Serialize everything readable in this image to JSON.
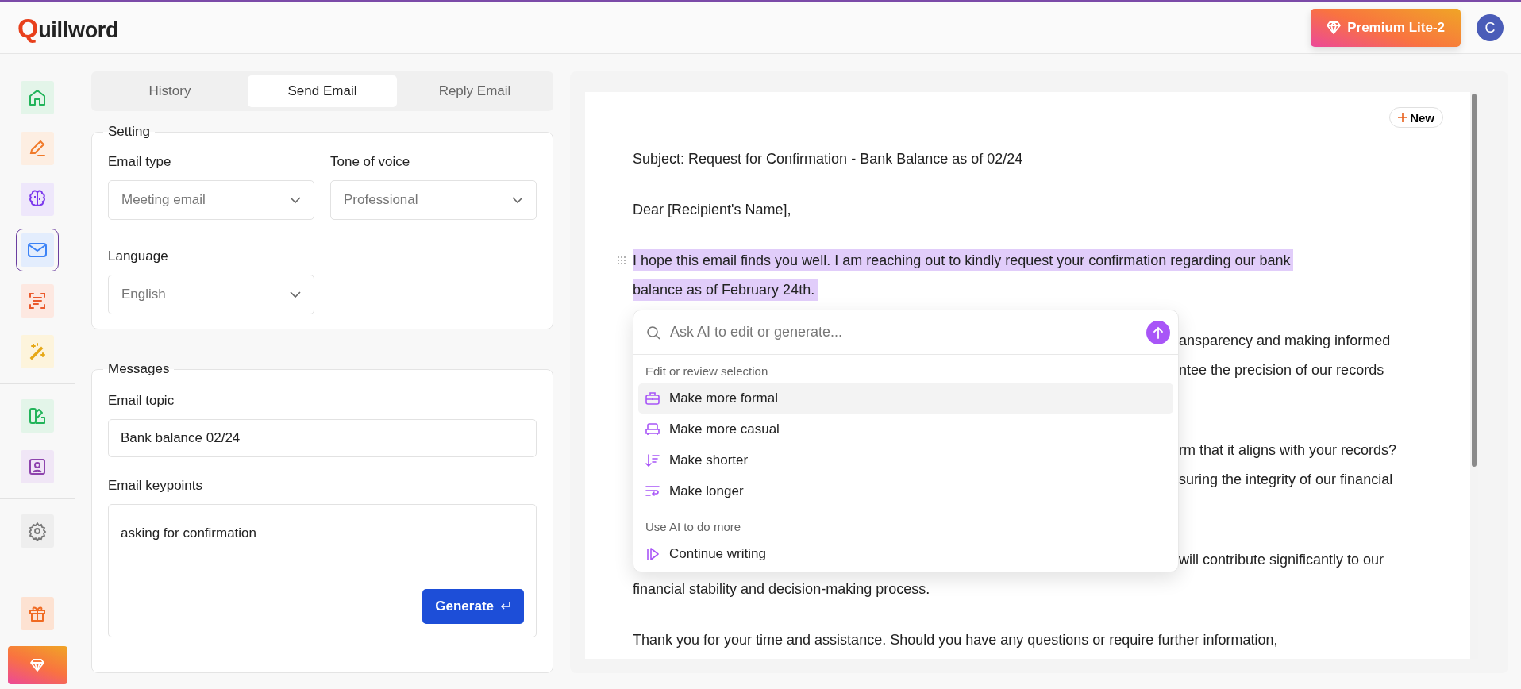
{
  "header": {
    "logo_initial": "Q",
    "logo_rest": "uillword",
    "premium_label": "Premium Lite-2",
    "avatar_initial": "C"
  },
  "sidebar": {
    "groups": [
      [
        {
          "kind": "home",
          "selected": false
        },
        {
          "kind": "pen",
          "selected": false
        },
        {
          "kind": "brain",
          "selected": false
        },
        {
          "kind": "mail",
          "selected": true
        },
        {
          "kind": "scan",
          "selected": false
        },
        {
          "kind": "wand",
          "selected": false
        }
      ],
      [
        {
          "kind": "swatch",
          "selected": false
        },
        {
          "kind": "contact",
          "selected": false
        }
      ],
      [
        {
          "kind": "gear",
          "selected": false
        }
      ]
    ],
    "bottom": [
      {
        "kind": "gift",
        "selected": false
      },
      {
        "kind": "premium",
        "selected": false
      }
    ]
  },
  "tabs": [
    {
      "label": "History",
      "selected": false
    },
    {
      "label": "Send Email",
      "selected": true
    },
    {
      "label": "Reply Email",
      "selected": false
    }
  ],
  "setting": {
    "title": "Setting",
    "fields": [
      {
        "label": "Email type",
        "value": "Meeting email"
      },
      {
        "label": "Tone of voice",
        "value": "Professional"
      },
      {
        "label": "Language",
        "value": "English"
      }
    ]
  },
  "messages": {
    "title": "Messages",
    "topic_label": "Email topic",
    "topic_value": "Bank balance 02/24",
    "keypoints_label": "Email keypoints",
    "keypoints_value": "asking for confirmation",
    "generate_label": "Generate"
  },
  "editor": {
    "new_label": "New",
    "paragraphs": [
      {
        "selected": false,
        "lines": [
          {
            "kind": "full",
            "text": "Subject: Request for Confirmation - Bank Balance as of 02/24"
          }
        ]
      },
      {
        "selected": false,
        "lines": [
          {
            "kind": "full",
            "text": "Dear [Recipient's Name],"
          }
        ]
      },
      {
        "selected": true,
        "lines": [
          {
            "kind": "full",
            "text": "I hope this email finds you well. I am reaching out to kindly request your confirmation regarding our bank"
          },
          {
            "kind": "full",
            "text": "balance as of February 24th."
          }
        ]
      },
      {
        "selected": false,
        "lines": [
          {
            "kind": "clipped",
            "text": "ansparency and making informed"
          },
          {
            "kind": "clipped",
            "text": "ntee the precision of our records"
          },
          {
            "kind": "covered"
          }
        ]
      },
      {
        "selected": false,
        "lines": [
          {
            "kind": "clipped",
            "text": "rm that it aligns with your records?"
          },
          {
            "kind": "clipped",
            "text": "suring the integrity of our financial"
          },
          {
            "kind": "covered"
          }
        ]
      },
      {
        "selected": false,
        "lines": [
          {
            "kind": "clipped",
            "text": "will contribute significantly to our"
          },
          {
            "kind": "full",
            "text": "financial stability and decision-making process."
          }
        ]
      },
      {
        "selected": false,
        "lines": [
          {
            "kind": "full",
            "text": "Thank you for your time and assistance. Should you have any questions or require further information,"
          }
        ]
      }
    ],
    "ai_menu": {
      "placeholder": "Ask AI to edit or generate...",
      "sections": [
        {
          "title": "Edit or review selection",
          "items": [
            {
              "kind": "briefcase",
              "label": "Make more formal",
              "selected": true
            },
            {
              "kind": "sofa",
              "label": "Make more casual",
              "selected": false
            },
            {
              "kind": "shorter",
              "label": "Make shorter",
              "selected": false
            },
            {
              "kind": "longer",
              "label": "Make longer",
              "selected": false
            }
          ]
        },
        {
          "title": "Use AI to do more",
          "items": [
            {
              "kind": "continue",
              "label": "Continue writing",
              "selected": false
            }
          ]
        }
      ]
    }
  }
}
